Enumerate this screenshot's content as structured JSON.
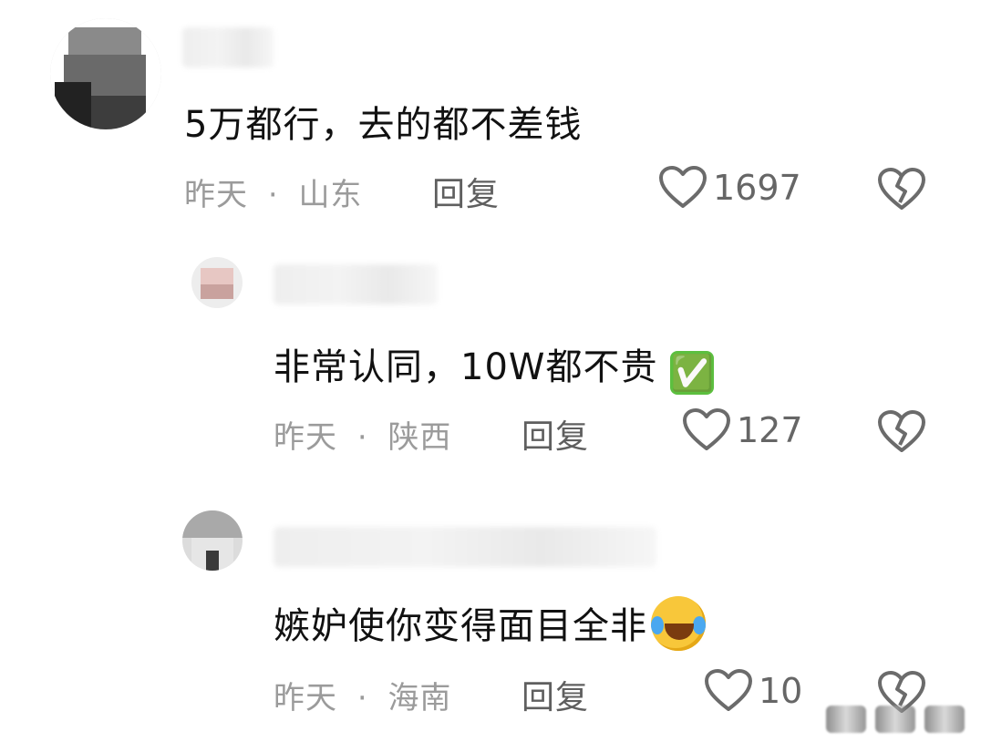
{
  "comments": [
    {
      "text": "5万都行，去的都不差钱",
      "time": "昨天",
      "sep": "·",
      "location": "山东",
      "reply_label": "回复",
      "likes": "1697"
    },
    {
      "text": "非常认同，10W都不贵",
      "emoji": "✅",
      "time": "昨天",
      "sep": "·",
      "location": "陕西",
      "reply_label": "回复",
      "likes": "127"
    },
    {
      "text": "嫉妒使你变得面目全非",
      "emoji": "laughing-crying-emoji",
      "time": "昨天",
      "sep": "·",
      "location": "海南",
      "reply_label": "回复",
      "likes": "10"
    }
  ],
  "colors": {
    "text": "#111111",
    "meta": "#9b9b9b",
    "reply": "#5f5f5f",
    "icon": "#6b6b6b"
  }
}
